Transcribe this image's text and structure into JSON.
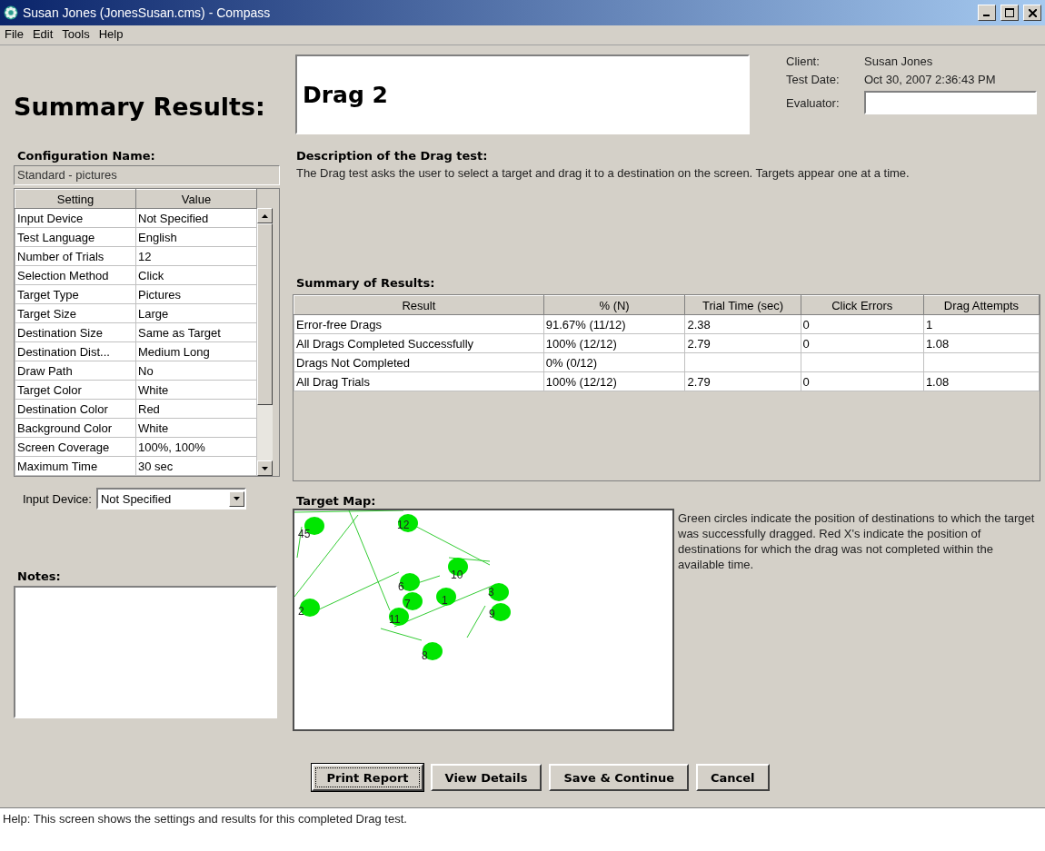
{
  "window": {
    "title": "Susan Jones (JonesSusan.cms) - Compass"
  },
  "menu": [
    "File",
    "Edit",
    "Tools",
    "Help"
  ],
  "heading": "Summary Results:",
  "test_name": "Drag 2",
  "info": [
    {
      "label": "Client:",
      "value": "Susan Jones",
      "kind": "text"
    },
    {
      "label": "Test Date:",
      "value": "Oct 30, 2007 2:36:43 PM",
      "kind": "text"
    },
    {
      "label": "Evaluator:",
      "kind": "field"
    }
  ],
  "configuration": {
    "label": "Configuration Name:",
    "name": "Standard - pictures",
    "columns": [
      "Setting",
      "Value"
    ],
    "rows": [
      [
        "Input Device",
        "Not Specified"
      ],
      [
        "Test Language",
        "English"
      ],
      [
        "Number of Trials",
        "12"
      ],
      [
        "Selection Method",
        "Click"
      ],
      [
        "Target Type",
        "Pictures"
      ],
      [
        "Target Size",
        "Large"
      ],
      [
        "Destination Size",
        "Same as Target"
      ],
      [
        "Destination Dist...",
        "Medium Long"
      ],
      [
        "Draw Path",
        "No"
      ],
      [
        "Target Color",
        "White"
      ],
      [
        "Destination Color",
        "Red"
      ],
      [
        "Background Color",
        "White"
      ],
      [
        "Screen Coverage",
        "100%, 100%"
      ],
      [
        "Maximum Time",
        "30 sec"
      ]
    ]
  },
  "input_device": {
    "label": "Input Device:",
    "value": "Not Specified"
  },
  "notes": {
    "label": "Notes:"
  },
  "description": {
    "label": "Description of the Drag test:",
    "text": "The Drag test asks the user to select a target and drag it to a destination on the screen.  Targets appear one at a time."
  },
  "summary": {
    "label": "Summary of Results:",
    "columns": [
      "Result",
      "% (N)",
      "Trial Time (sec)",
      "Click Errors",
      "Drag Attempts"
    ],
    "rows": [
      [
        "Error-free Drags",
        "91.67% (11/12)",
        "2.38",
        "0",
        "1"
      ],
      [
        "All Drags Completed Successfully",
        "100% (12/12)",
        "2.79",
        "0",
        "1.08"
      ],
      [
        "Drags Not Completed",
        "0% (0/12)",
        "",
        "",
        ""
      ],
      [
        "All Drag Trials",
        "100% (12/12)",
        "2.79",
        "0",
        "1.08"
      ]
    ]
  },
  "target_map": {
    "label": "Target Map:",
    "points": [
      {
        "label": "45"
      },
      {
        "label": "12"
      },
      {
        "label": "10"
      },
      {
        "label": "6"
      },
      {
        "label": "7"
      },
      {
        "label": "1"
      },
      {
        "label": "3"
      },
      {
        "label": "9"
      },
      {
        "label": "2"
      },
      {
        "label": "11"
      },
      {
        "label": "8"
      }
    ],
    "legend": "Green circles indicate the position of destinations to which the target was successfully dragged. Red X's indicate the position of destinations for which the drag was not completed within the available time."
  },
  "buttons": [
    {
      "label": "Print Report",
      "focused": true
    },
    {
      "label": "View Details",
      "focused": false
    },
    {
      "label": "Save & Continue",
      "focused": false
    },
    {
      "label": "Cancel",
      "focused": false
    }
  ],
  "help": "Help:  This screen shows the settings and results for this completed Drag test."
}
